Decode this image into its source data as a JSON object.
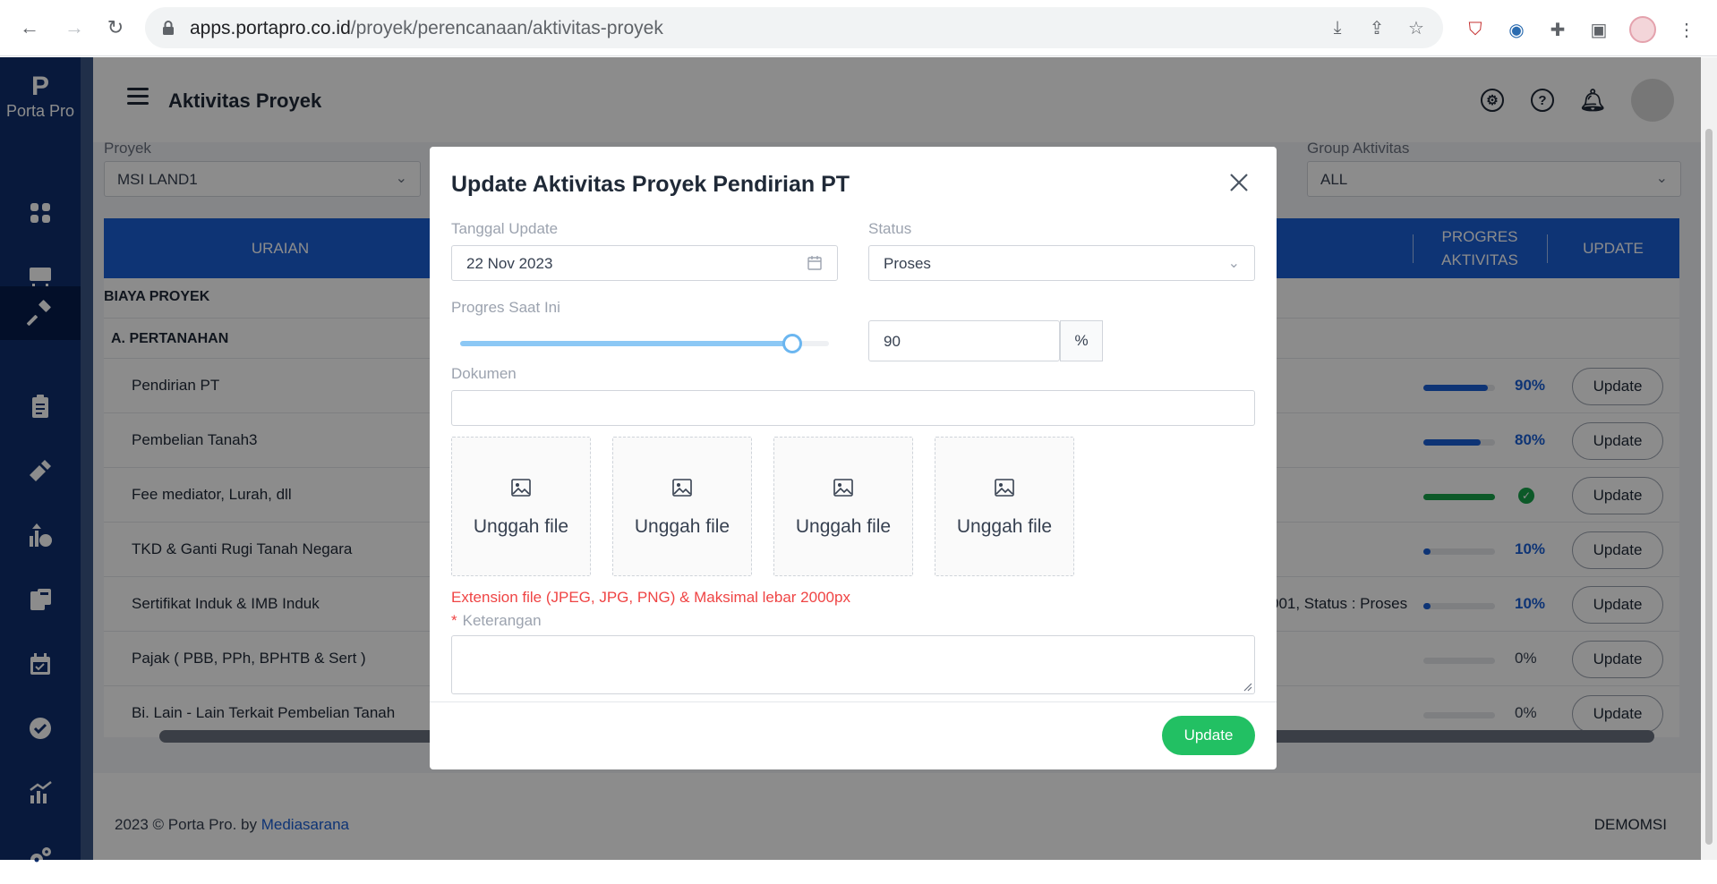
{
  "browser": {
    "url_host": "apps.portapro.co.id",
    "url_path": "/proyek/perencanaan/aktivitas-proyek"
  },
  "app": {
    "brand_logo": "P",
    "brand_name": "Porta Pro",
    "page_title": "Aktivitas Proyek"
  },
  "filters": {
    "proyek_label": "Proyek",
    "proyek_value": "MSI LAND1",
    "group_label": "Group Aktivitas",
    "group_value": "ALL"
  },
  "table": {
    "col_uraian": "URAIAN",
    "col_progres": "PROGRES AKTIVITAS",
    "col_update": "UPDATE",
    "section": "BIAYA PROYEK",
    "group": "A. PERTANAHAN",
    "rows": [
      {
        "name": "Pendirian PT",
        "extra": "",
        "progress": 90,
        "pct": "90%",
        "done": false,
        "btn": "Update"
      },
      {
        "name": "Pembelian Tanah3",
        "extra": "",
        "progress": 80,
        "pct": "80%",
        "done": false,
        "btn": "Update"
      },
      {
        "name": "Fee mediator, Lurah, dll",
        "extra": "",
        "progress": 100,
        "pct": "",
        "done": true,
        "btn": "Update"
      },
      {
        "name": "TKD & Ganti Rugi Tanah Negara",
        "extra": "",
        "progress": 10,
        "pct": "10%",
        "done": false,
        "btn": "Update"
      },
      {
        "name": "Sertifikat Induk & IMB Induk",
        "extra": "001, Status : Proses",
        "progress": 10,
        "pct": "10%",
        "done": false,
        "btn": "Update"
      },
      {
        "name": "Pajak ( PBB, PPh, BPHTB & Sert )",
        "extra": "",
        "progress": 0,
        "pct": "0%",
        "done": false,
        "btn": "Update"
      },
      {
        "name": "Bi. Lain - Lain Terkait Pembelian Tanah",
        "extra": "",
        "progress": 0,
        "pct": "0%",
        "done": false,
        "btn": "Update"
      }
    ]
  },
  "footer": {
    "copyright": "2023 © Porta Pro. by ",
    "company": "Mediasarana",
    "org": "DEMOMSI"
  },
  "modal": {
    "title": "Update Aktivitas Proyek Pendirian PT",
    "tanggal_label": "Tanggal Update",
    "tanggal_value": "22 Nov 2023",
    "status_label": "Status",
    "status_value": "Proses",
    "progres_label": "Progres Saat Ini",
    "progres_value": "90",
    "progres_fraction": 0.9,
    "pct_unit": "%",
    "dokumen_label": "Dokumen",
    "upload_label": "Unggah file",
    "hint": "Extension file (JPEG, JPG, PNG) & Maksimal lebar 2000px",
    "keterangan_label": "Keterangan",
    "required_mark": "*",
    "submit": "Update"
  },
  "colors": {
    "sidebar": "#0f2f6d",
    "table_header": "#1b5fd6",
    "success": "#22c063",
    "done_bar": "#16a34a"
  }
}
